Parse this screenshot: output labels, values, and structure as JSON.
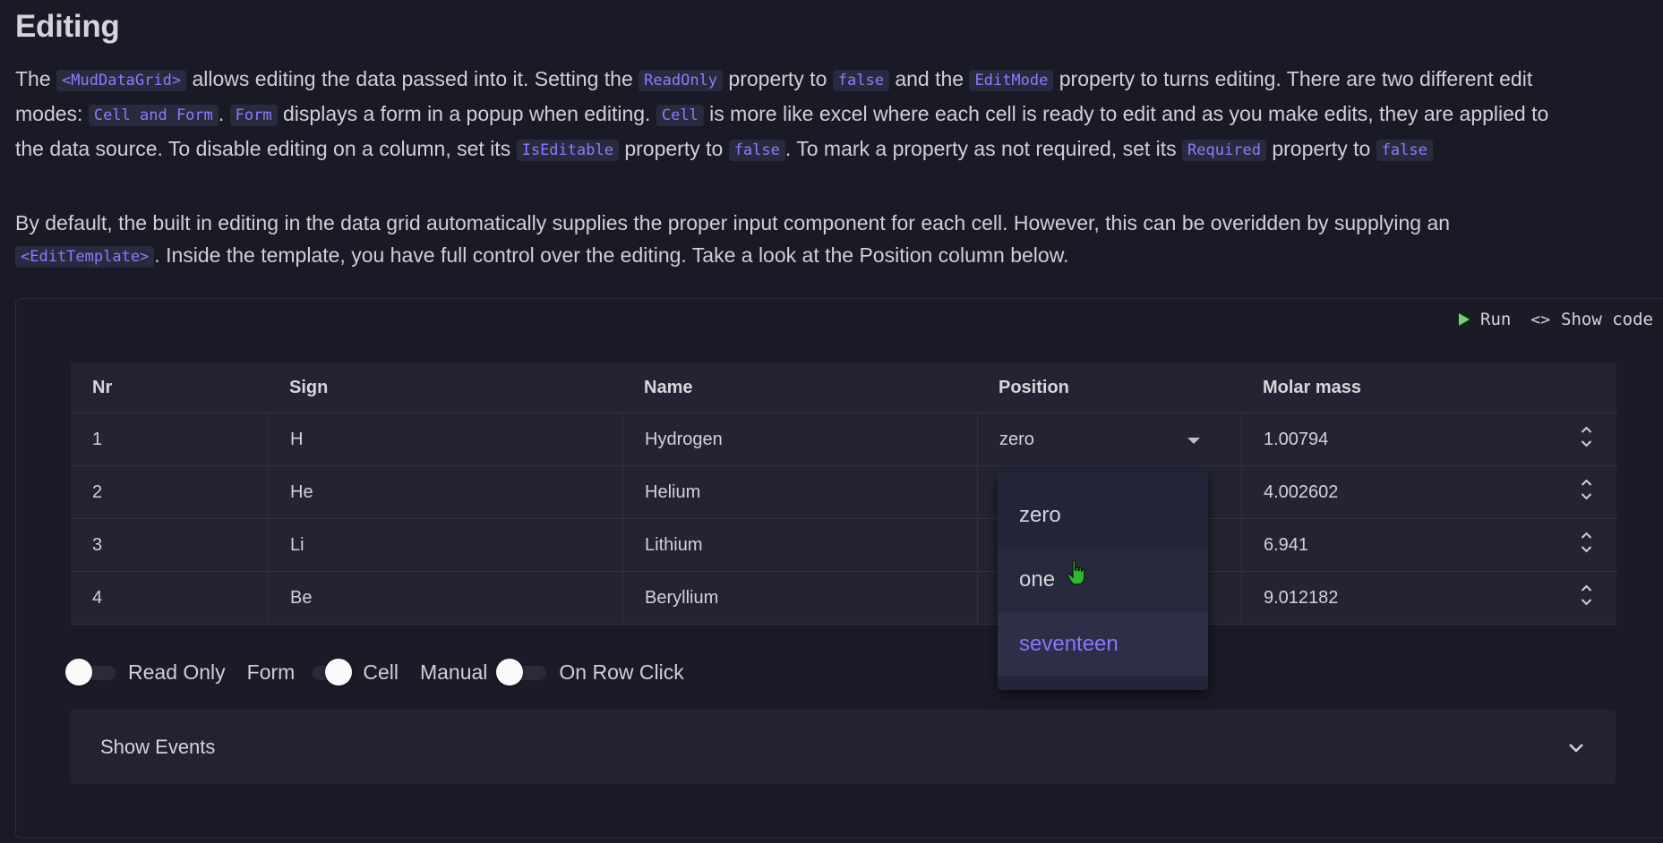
{
  "page": {
    "title": "Editing"
  },
  "intro": {
    "p1_l1": [
      "The ",
      "<MudDataGrid>",
      " allows editing the data passed into it. Setting the ",
      "ReadOnly",
      " property to ",
      "false",
      " and the ",
      "EditMode",
      " property to turns editing. There are two different edit"
    ],
    "p1_l2": [
      "modes: ",
      "Cell and Form",
      ". ",
      "Form",
      " displays a form in a popup when editing. ",
      "Cell",
      " is more like excel where each cell is ready to edit and as you make edits, they are applied to"
    ],
    "p1_l3": [
      "the data source. To disable editing on a column, set its ",
      "IsEditable",
      " property to ",
      "false",
      ". To mark a property as not required, set its ",
      "Required",
      " property to ",
      "false"
    ],
    "p2_l1": [
      "By default, the built in editing in the data grid automatically supplies the proper input component for each cell. However, this can be overidden by supplying an"
    ],
    "p2_l2": [
      "<EditTemplate>",
      ". Inside the template, you have full control over the editing. Take a look at the Position column below."
    ]
  },
  "toolbar": {
    "run_label": "Run",
    "show_code_label": "Show code",
    "code_glyph": "<>"
  },
  "grid": {
    "headers": [
      "Nr",
      "Sign",
      "Name",
      "Position",
      "Molar mass"
    ],
    "rows": [
      {
        "nr": "1",
        "sign": "H",
        "name": "Hydrogen",
        "position": "zero",
        "molar": "1.00794"
      },
      {
        "nr": "2",
        "sign": "He",
        "name": "Helium",
        "position": "",
        "molar": "4.002602"
      },
      {
        "nr": "3",
        "sign": "Li",
        "name": "Lithium",
        "position": "",
        "molar": "6.941"
      },
      {
        "nr": "4",
        "sign": "Be",
        "name": "Beryllium",
        "position": "",
        "molar": "9.012182"
      }
    ]
  },
  "dropdown": {
    "options": [
      "zero",
      "one",
      "seventeen"
    ],
    "hovered": "one",
    "selected": "seventeen"
  },
  "controls": {
    "read_only_label": "Read Only",
    "form_label": "Form",
    "cell_label": "Cell",
    "manual_label": "Manual",
    "on_row_click_label": "On Row Click",
    "read_only": false,
    "edit_mode_cell": true,
    "on_row_click": false
  },
  "events": {
    "label": "Show Events"
  },
  "colors": {
    "accent": "#8b74ff",
    "run_icon": "#6fd46a",
    "background": "#1a1a27"
  }
}
